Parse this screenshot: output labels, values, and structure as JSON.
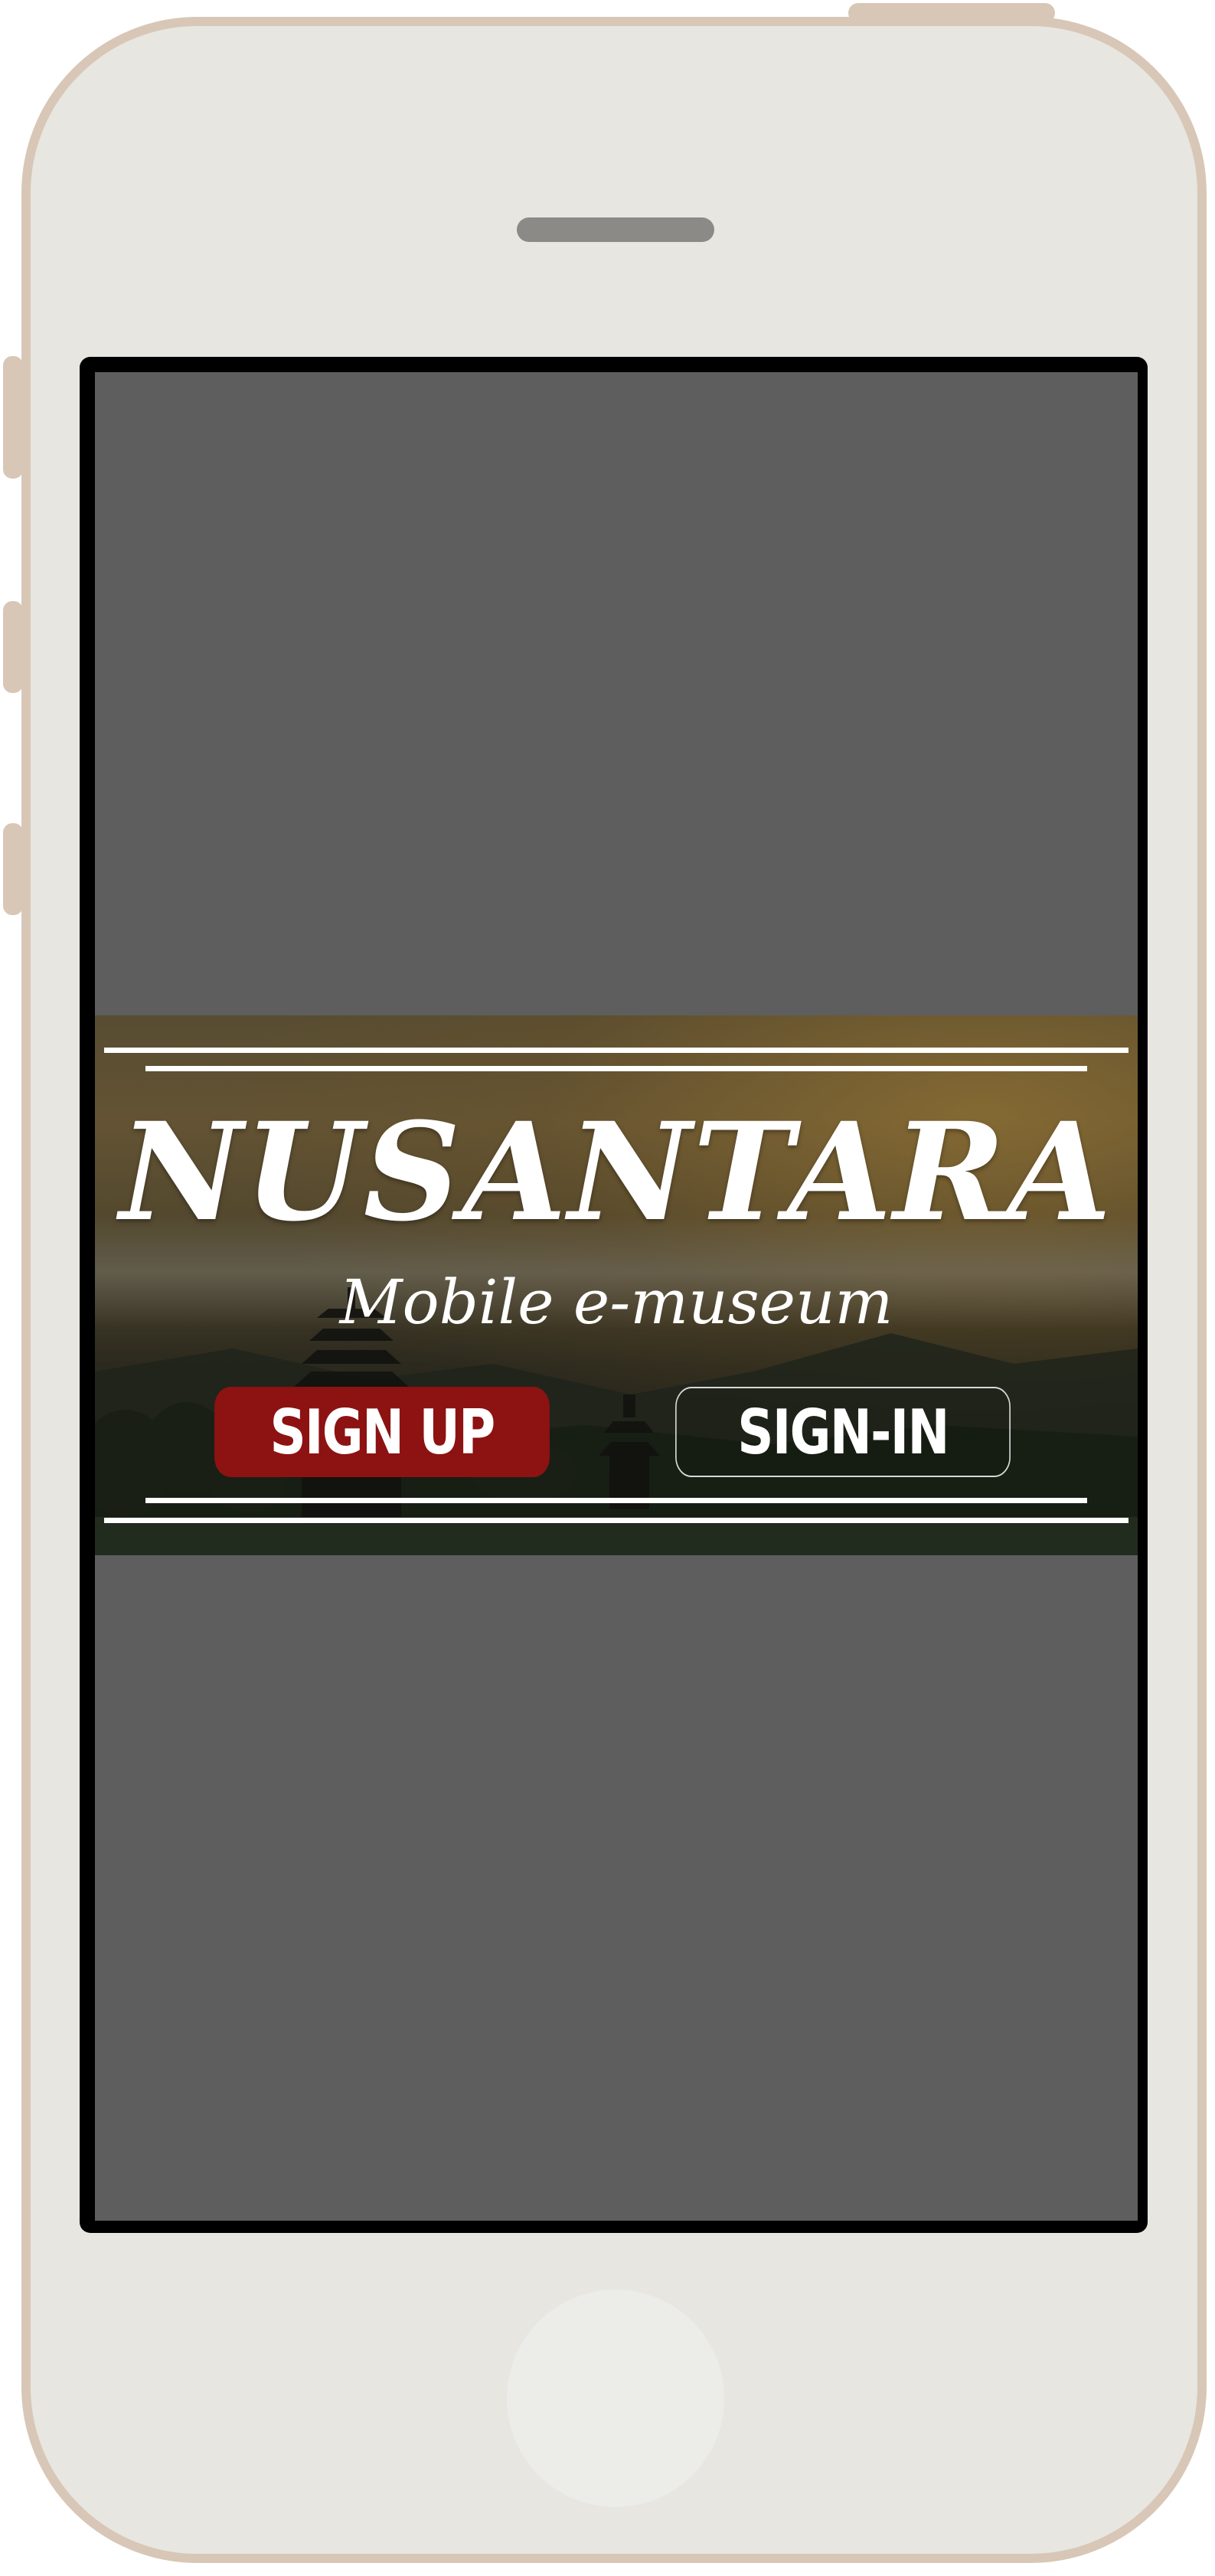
{
  "app": {
    "title": "NUSANTARA",
    "subtitle": "Mobile e-museum"
  },
  "buttons": {
    "signup_label": "SIGN UP",
    "signin_label": "SIGN-IN"
  },
  "colors": {
    "signup_bg": "#8d1212",
    "screen_bg": "#5e5e5e",
    "phone_body": "#e7e6e1",
    "phone_border": "#d8c7b6"
  },
  "icons": {
    "background_image": "temple-lake-landscape"
  }
}
